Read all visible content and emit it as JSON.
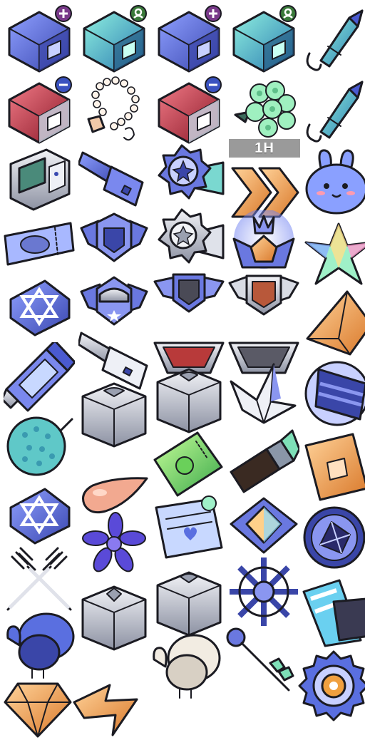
{
  "sheet": {
    "timer_badge": "1H"
  },
  "colors": {
    "blue": "#5a6fe0",
    "blue_light": "#a9b8ff",
    "teal": "#3fd3b8",
    "green": "#7ee07a",
    "red": "#d43848",
    "silver": "#c9ccd6",
    "orange": "#f0a040",
    "peach": "#f2a990",
    "outline": "#1b1b22"
  },
  "icons": [
    "cube-chest-blue-plus-icon",
    "cube-chest-teal-upgrade-icon",
    "cube-chest-blue-upgrade-icon",
    "cube-chest-blue-upgrade-icon",
    "firework-rocket-teal-icon",
    "cube-chest-red-minus-icon",
    "prayer-beads-icon",
    "cube-chest-red-minus-icon",
    "flower-bouquet-icon",
    "firework-rocket-teal-icon",
    "arcade-machine-icon",
    "usb-key-icon",
    "star-badge-ribbon-icon",
    "double-chevron-icon",
    "bunny-jelly-icon",
    "ticket-icon",
    "winged-shield-badge-icon",
    "star-badge-silver-icon",
    "crown-rank-badge-icon",
    "crystal-star-icon",
    "magic-triangle-sigil-icon",
    "winged-cap-badge-icon",
    "winged-shield-small-icon",
    "winged-shield-bronze-icon",
    "pyramid-gem-icon",
    "usb-stick-icon",
    "red-banner-badge-icon",
    "grey-banner-badge-icon",
    "battery-capsule-icon",
    "supply-crate-icon",
    "paper-crane-icon",
    "cake-slice-icon",
    "spiky-ball-icon",
    "supply-crate-icon",
    "green-voucher-icon",
    "lipstick-icon",
    "fist-card-icon",
    "magic-triangle-sigil-icon",
    "water-drop-icon",
    "violet-flower-icon",
    "love-letter-icon",
    "prism-gem-badge-icon",
    "crystal-coin-icon",
    "crossed-forks-icon",
    "diamond-crate-icon",
    "supply-crate-icon",
    "ship-wheel-icon",
    "chocolate-bar-icon",
    "turkey-blue-icon",
    "turkey-white-icon",
    "key-icon",
    "gear-target-icon",
    "orange-gem-icon",
    "lightning-bolt-icon"
  ]
}
